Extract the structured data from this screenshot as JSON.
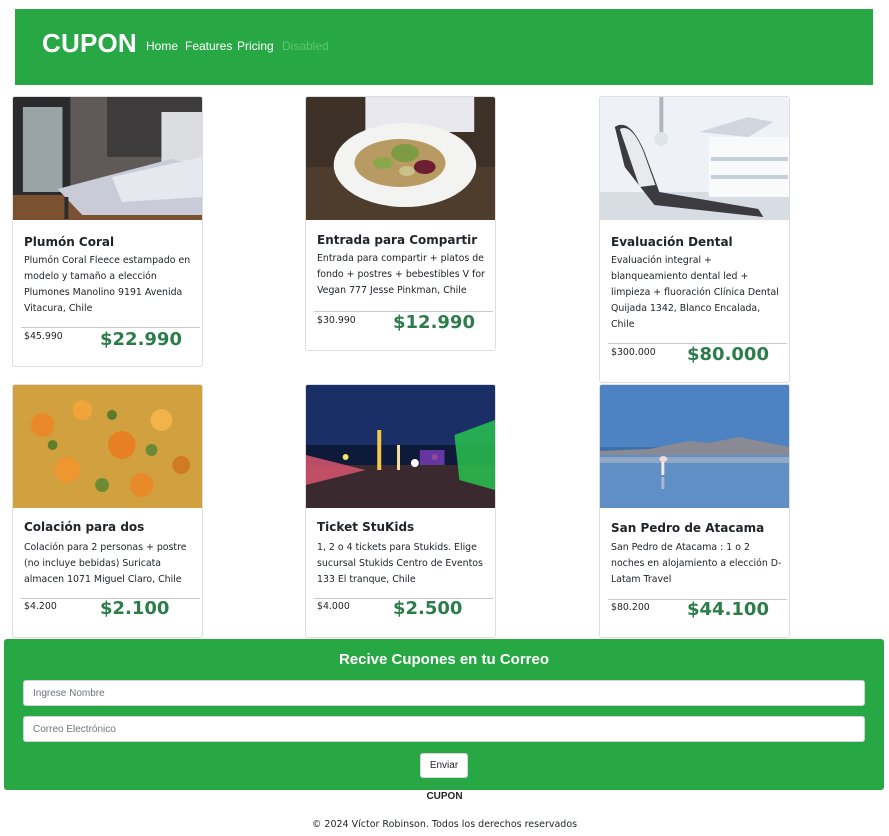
{
  "navbar": {
    "brand": "CUPON",
    "links": [
      "Home",
      "Features",
      "Pricing",
      "Disabled"
    ]
  },
  "cards": [
    {
      "title": "Plumón Coral",
      "description": "Plumón Coral Fleece estampado en modelo y tamaño a elección Plumones Manolino 9191 Avenida Vitacura, Chile",
      "old_price": "$45.990",
      "new_price": "$22.990"
    },
    {
      "title": "Entrada para Compartir",
      "description": "Entrada para compartir + platos de fondo + postres + bebestibles V for Vegan 777 Jesse Pinkman, Chile",
      "old_price": "$30.990",
      "new_price": "$12.990"
    },
    {
      "title": "Evaluación Dental",
      "description": "Evaluación integral + blanqueamiento dental led + limpieza + fluoración Clínica Dental Quijada 1342, Blanco Encalada, Chile",
      "old_price": "$300.000",
      "new_price": "$80.000"
    },
    {
      "title": "Colación para dos",
      "description": "Colación para 2 personas + postre (no incluye bebidas) Suricata almacen 1071 Miguel Claro, Chile",
      "old_price": "$4.200",
      "new_price": "$2.100"
    },
    {
      "title": "Ticket StuKids",
      "description": "1, 2 o 4 tickets para Stukids. Elige sucursal Stukids Centro de Eventos 133 El tranque, Chile",
      "old_price": "$4.000",
      "new_price": "$2.500"
    },
    {
      "title": "San Pedro de Atacama",
      "description": "San Pedro de Atacama : 1 o 2 noches en alojamiento a elección D-Latam Travel",
      "old_price": "$80.200",
      "new_price": "$44.100"
    }
  ],
  "subscribe": {
    "title": "Recive Cupones en tu Correo",
    "name_placeholder": "Ingrese Nombre",
    "email_placeholder": "Correo Electrónico",
    "button": "Enviar"
  },
  "footer": {
    "brand": "CUPON",
    "copyright": "© 2024 Víctor Robinson. Todos los derechos reservados"
  },
  "colors": {
    "brand_green": "#28a745",
    "price_green": "#2d7d4a"
  }
}
